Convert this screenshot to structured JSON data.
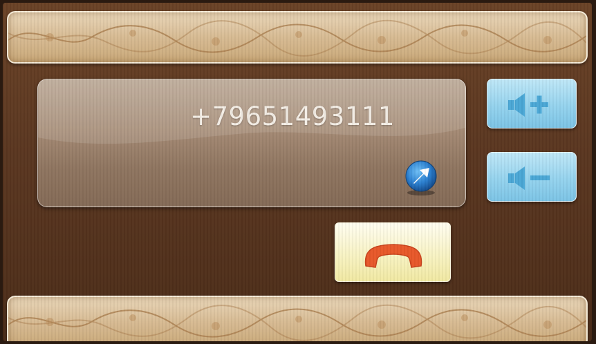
{
  "call": {
    "phone_number": "+79651493111"
  },
  "icons": {
    "transfer": "arrow-up-right-icon",
    "volume_up": "speaker-plus-icon",
    "volume_down": "speaker-minus-icon",
    "hangup": "phone-hangup-icon"
  },
  "colors": {
    "background": "#5a3620",
    "panel": "#a48a74",
    "volume_button": "#95d3ee",
    "hangup_button": "#f8f3c4",
    "hangup_icon": "#e8582a",
    "transfer_icon": "#2a7fd0"
  }
}
